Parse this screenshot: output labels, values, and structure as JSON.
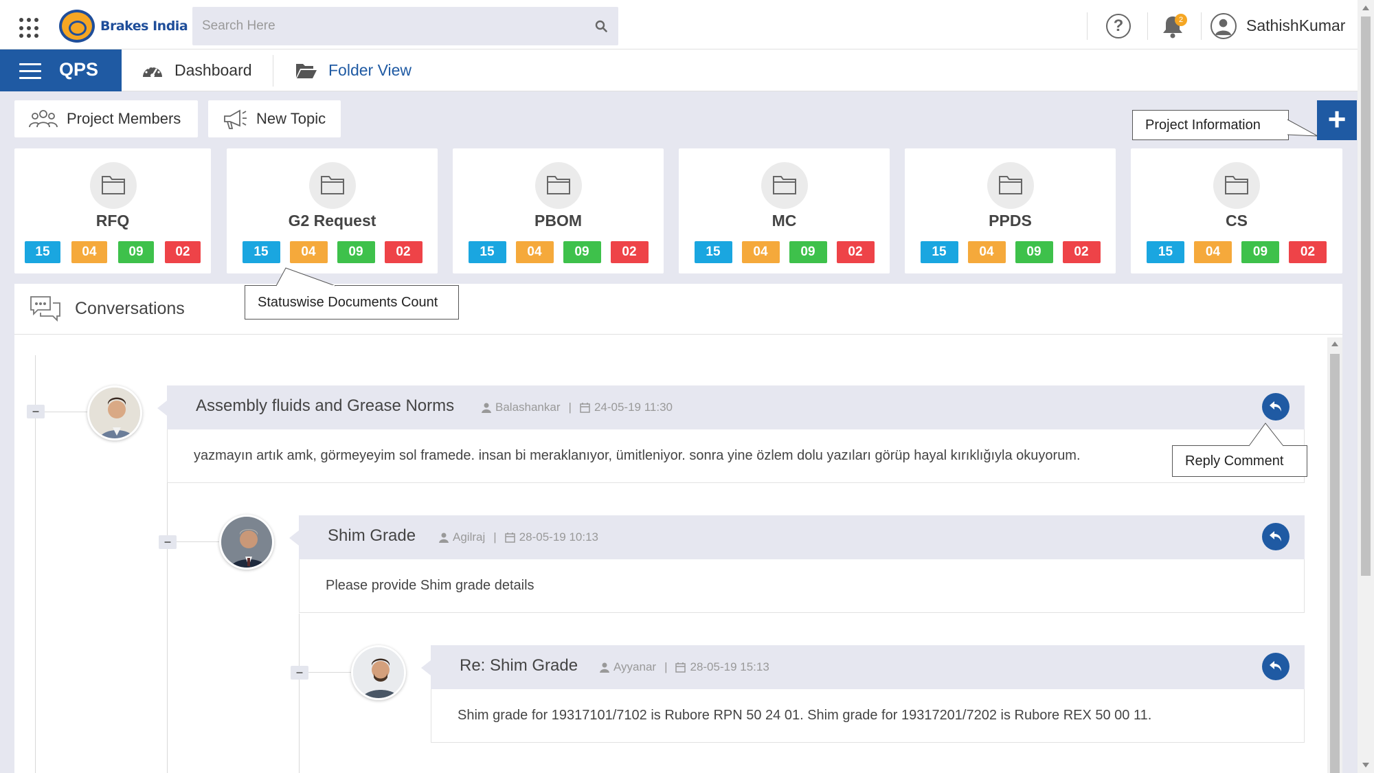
{
  "header": {
    "brand": "Brakes India",
    "search_placeholder": "Search Here",
    "notification_count": "2",
    "user_name": "SathishKumar",
    "icons": [
      "apps-grid-icon",
      "search-icon",
      "help-icon",
      "bell-icon",
      "user-avatar-icon"
    ]
  },
  "nav": {
    "app_name": "QPS",
    "dashboard_label": "Dashboard",
    "folder_view_label": "Folder View",
    "active_color": "#1f5aa3"
  },
  "actions": {
    "project_members_label": "Project Members",
    "new_topic_label": "New Topic",
    "add_label": "+"
  },
  "callouts": {
    "project_information": "Project Information",
    "statuswise_documents_count": "Statuswise Documents Count",
    "reply_comment": "Reply Comment"
  },
  "status_colors": {
    "blue": "#1aa6e0",
    "orange": "#f5a93b",
    "green": "#3ec14b",
    "red": "#ee4348"
  },
  "folders": [
    {
      "name": "RFQ",
      "counts": [
        "15",
        "04",
        "09",
        "02"
      ]
    },
    {
      "name": "G2 Request",
      "counts": [
        "15",
        "04",
        "09",
        "02"
      ]
    },
    {
      "name": "PBOM",
      "counts": [
        "15",
        "04",
        "09",
        "02"
      ]
    },
    {
      "name": "MC",
      "counts": [
        "15",
        "04",
        "09",
        "02"
      ]
    },
    {
      "name": "PPDS",
      "counts": [
        "15",
        "04",
        "09",
        "02"
      ]
    },
    {
      "name": "CS",
      "counts": [
        "15",
        "04",
        "09",
        "02"
      ]
    }
  ],
  "conversations": {
    "title": "Conversations",
    "comments": [
      {
        "title": "Assembly fluids and Grease Norms",
        "author": "Balashankar",
        "datetime": "24-05-19 11:30",
        "body": "yazmayın artık amk, görmeyeyim sol framede. insan bi meraklanıyor, ümitleniyor. sonra yine özlem dolu yazıları görüp hayal kırıklığıyla okuyorum."
      },
      {
        "title": "Shim Grade",
        "author": "Agilraj",
        "datetime": "28-05-19 10:13",
        "body": "Please provide Shim grade details"
      },
      {
        "title": "Re: Shim Grade",
        "author": "Ayyanar",
        "datetime": "28-05-19 15:13",
        "body": "Shim grade for 19317101/7102 is Rubore RPN 50 24 01. Shim grade for 19317201/7202 is Rubore REX 50 00 11."
      }
    ]
  }
}
